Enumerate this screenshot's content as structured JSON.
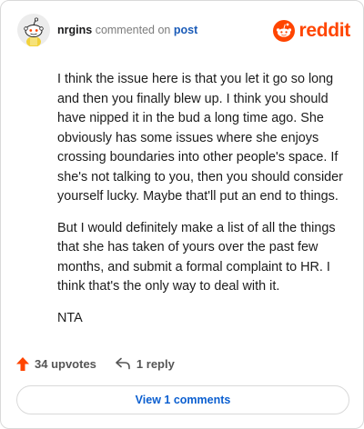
{
  "comment": {
    "author": "nrgins",
    "action_text": "commented on",
    "post_link": "post",
    "paragraphs": [
      "I think the issue here is that you let it go so long and then you finally blew up. I think you should have nipped it in the bud a long time ago. She obviously has some issues where she enjoys crossing boundaries into other people's space. If she's not talking to you, then you should consider yourself lucky. Maybe that'll put an end to things.",
      "But I would definitely make a list of all the things that she has taken of yours over the past few months, and submit a formal complaint to HR. I think that's the only way to deal with it.",
      "NTA"
    ]
  },
  "brand": {
    "name": "reddit",
    "color": "#ff4500"
  },
  "actions": {
    "upvotes_label": "34 upvotes",
    "reply_label": "1 reply",
    "view_comments_label": "View 1 comments"
  },
  "icons": {
    "avatar": "snoo-avatar-icon",
    "logo": "reddit-logo-icon",
    "upvote": "upvote-arrow-icon",
    "reply": "reply-arrow-icon"
  },
  "colors": {
    "upvote": "#ff4500",
    "link": "#0b5fd0"
  }
}
